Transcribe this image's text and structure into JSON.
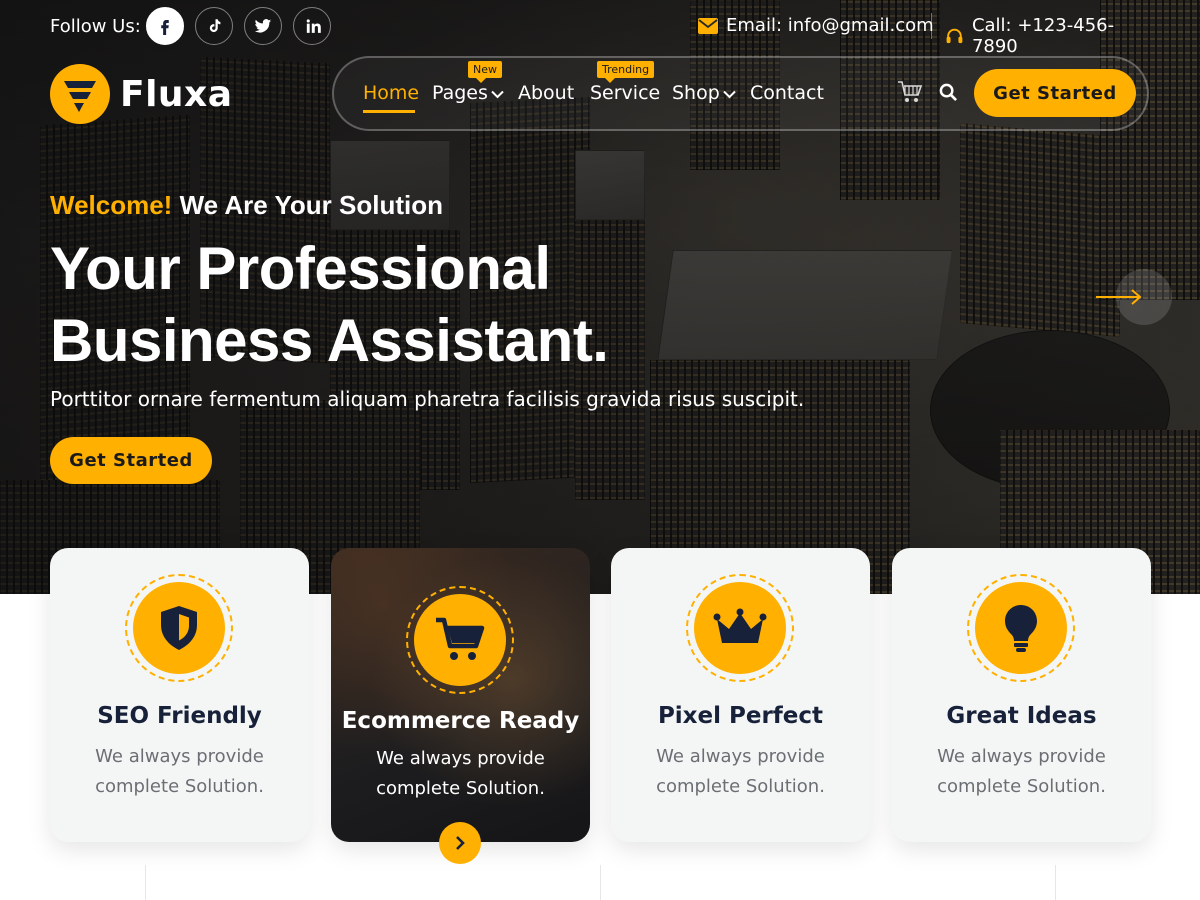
{
  "topbar": {
    "follow_label": "Follow Us:",
    "socials": [
      {
        "name": "facebook-icon",
        "active": true
      },
      {
        "name": "tiktok-icon",
        "active": false
      },
      {
        "name": "twitter-icon",
        "active": false
      },
      {
        "name": "linkedin-icon",
        "active": false
      }
    ],
    "email": "Email: info@gmail.com",
    "phone": "Call: +123-456-7890"
  },
  "brand": {
    "name": "Fluxa",
    "accent": "#ffb000",
    "dark": "#17213a"
  },
  "nav": {
    "items": [
      {
        "label": "Home",
        "active": true,
        "badge": "",
        "dropdown": false
      },
      {
        "label": "Pages",
        "active": false,
        "badge": "New",
        "dropdown": true
      },
      {
        "label": "About",
        "active": false,
        "badge": "",
        "dropdown": false
      },
      {
        "label": "Service",
        "active": false,
        "badge": "Trending",
        "dropdown": false
      },
      {
        "label": "Shop",
        "active": false,
        "badge": "",
        "dropdown": true
      },
      {
        "label": "Contact",
        "active": false,
        "badge": "",
        "dropdown": false
      }
    ],
    "cta_label": "Get Started"
  },
  "hero": {
    "welcome_highlight": "Welcome!",
    "welcome_rest": "We Are Your Solution",
    "headline_line1": "Your Professional",
    "headline_line2": "Business Assistant.",
    "subtitle": "Porttitor ornare fermentum aliquam pharetra facilisis gravida risus suscipit.",
    "cta_label": "Get Started"
  },
  "features": [
    {
      "title": "SEO Friendly",
      "desc": "We always provide complete Solution.",
      "icon": "shield-icon",
      "featured": false
    },
    {
      "title": "Ecommerce Ready",
      "desc": "We always provide complete Solution.",
      "icon": "cart-icon",
      "featured": true
    },
    {
      "title": "Pixel Perfect",
      "desc": "We always provide complete Solution.",
      "icon": "crown-icon",
      "featured": false
    },
    {
      "title": "Great Ideas",
      "desc": "We always provide complete Solution.",
      "icon": "lightbulb-icon",
      "featured": false
    }
  ]
}
